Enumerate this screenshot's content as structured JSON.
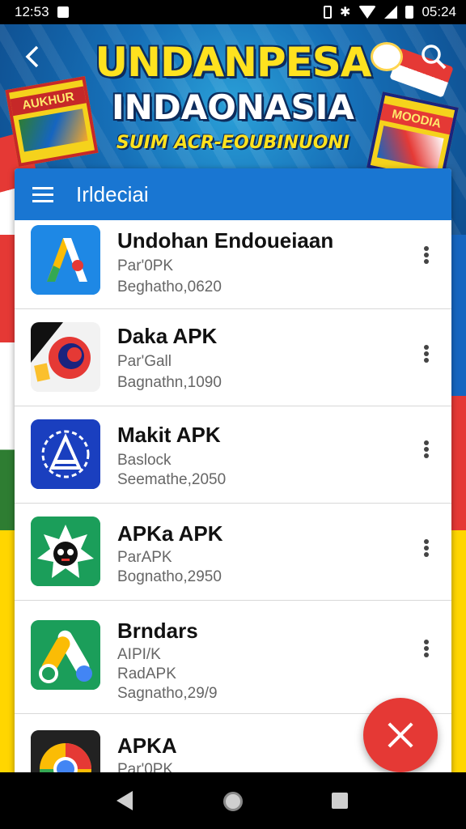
{
  "status_bar": {
    "time": "12:53",
    "right_time": "05:24"
  },
  "banner": {
    "title_line1": "UNDANPESA",
    "title_line2": "INDAONASIA",
    "subtitle": "SUIM ACR-EOUBINUONI",
    "book_left_title": "AUKHUR",
    "book_right_title": "MOODIA"
  },
  "header": {
    "title": "Irldeciai"
  },
  "apps": [
    {
      "name": "Undohan Endoueiaan",
      "line1": "Par'0PK",
      "line2": "Beghatho,0620",
      "icon": "arrow-a-icon",
      "icon_bg": "#1e88e5"
    },
    {
      "name": "Daka APK",
      "line1": "Par'Gall",
      "line2": "Bagnathn,1090",
      "icon": "red-badge-icon",
      "icon_bg": "#f2f2f2"
    },
    {
      "name": "Makit APK",
      "line1": "Baslock",
      "line2": "Seemathe,2050",
      "icon": "shield-emblem-icon",
      "icon_bg": "#1a3fbf"
    },
    {
      "name": "APKa APK",
      "line1": "ParAPK",
      "line2": "Bognatho,2950",
      "icon": "star-face-icon",
      "icon_bg": "#1b9e5a"
    },
    {
      "name": "Brndars",
      "line1": "AIPI/K",
      "line2": "RadAPK",
      "line3": "Sagnatho,29/9",
      "icon": "ads-shape-icon",
      "icon_bg": "#1b9e5a"
    },
    {
      "name": "APKA",
      "line1": "Par'0PK",
      "icon": "chrome-like-icon",
      "icon_bg": "#222222"
    }
  ],
  "colors": {
    "header_blue": "#1976d2",
    "fab_red": "#e53935"
  }
}
